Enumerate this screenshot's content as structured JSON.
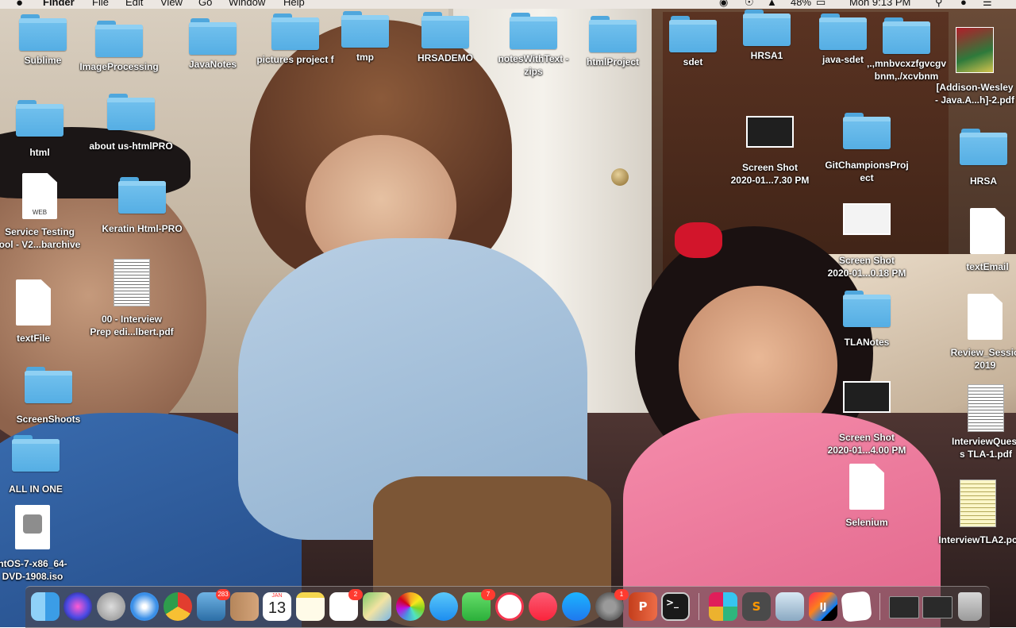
{
  "menubar": {
    "finder": "Finder",
    "menus": [
      "File",
      "Edit",
      "View",
      "Go",
      "Window",
      "Help"
    ],
    "battery": "48%",
    "clock": "Mon 9:13 PM"
  },
  "desktop": {
    "items": [
      {
        "label": "Sublime",
        "kind": "folder"
      },
      {
        "label": "ImageProcessing",
        "kind": "folder"
      },
      {
        "label": "JavaNotes",
        "kind": "folder"
      },
      {
        "label": "pictures project f",
        "kind": "folder"
      },
      {
        "label": "tmp",
        "kind": "folder"
      },
      {
        "label": "HRSADEMO",
        "kind": "folder"
      },
      {
        "label": "notesWithText -",
        "label2": "zips",
        "kind": "folder"
      },
      {
        "label": "htmlProject",
        "kind": "folder"
      },
      {
        "label": "sdet",
        "kind": "folder"
      },
      {
        "label": "HRSA1",
        "kind": "folder"
      },
      {
        "label": "java-sdet",
        "kind": "folder"
      },
      {
        "label": ",.,mnbvcxzfgvcgv",
        "label2": "bnm,./xcvbnm",
        "kind": "folder"
      },
      {
        "label": "[Addison-Wesley",
        "label2": "- Java.A...h]-2.pdf",
        "kind": "book"
      },
      {
        "label": "html",
        "kind": "folder"
      },
      {
        "label": "about us-htmlPRO",
        "kind": "folder"
      },
      {
        "label": "Screen Shot",
        "label2": "2020-01...7.30 PM",
        "kind": "screenshot-dark"
      },
      {
        "label": "GitChampionsProj",
        "label2": "ect",
        "kind": "folder"
      },
      {
        "label": "HRSA",
        "kind": "folder"
      },
      {
        "label": "Service Testing",
        "label2": "ool - V2...barchive",
        "kind": "doc-web",
        "badge": "WEB"
      },
      {
        "label": "Keratin Html-PRO",
        "kind": "folder"
      },
      {
        "label": "Screen Shot",
        "label2": "2020-01...0.18 PM",
        "kind": "screenshot-light"
      },
      {
        "label": "textEmail",
        "kind": "doc"
      },
      {
        "label": "00 - Interview",
        "label2": "Prep edi...lbert.pdf",
        "kind": "pdf"
      },
      {
        "label": "textFile",
        "kind": "doc"
      },
      {
        "label": "TLANotes",
        "kind": "folder"
      },
      {
        "label": "Review_Sessio",
        "label2": "2019",
        "kind": "doc"
      },
      {
        "label": "ScreenShoots",
        "kind": "folder"
      },
      {
        "label": "Screen Shot",
        "label2": "2020-01...4.00 PM",
        "kind": "screenshot-dark"
      },
      {
        "label": "InterviewQuest",
        "label2": "s TLA-1.pdf",
        "kind": "pdf"
      },
      {
        "label": "ALL IN ONE",
        "kind": "folder"
      },
      {
        "label": "Selenium",
        "kind": "doc"
      },
      {
        "label": "InterviewTLA2.pc",
        "kind": "pdf"
      },
      {
        "label": "ntOS-7-x86_64-",
        "label2": "DVD-1908.iso",
        "kind": "disk"
      }
    ]
  },
  "dock": {
    "mail_badge": "283",
    "reminders_badge": "2",
    "facetime_badge": "7",
    "sysprefs_badge": "1",
    "calendar_month": "JAN",
    "calendar_day": "13",
    "powerpoint_glyph": "P",
    "terminal_glyph": ">_",
    "intellij_glyph": "IJ"
  }
}
